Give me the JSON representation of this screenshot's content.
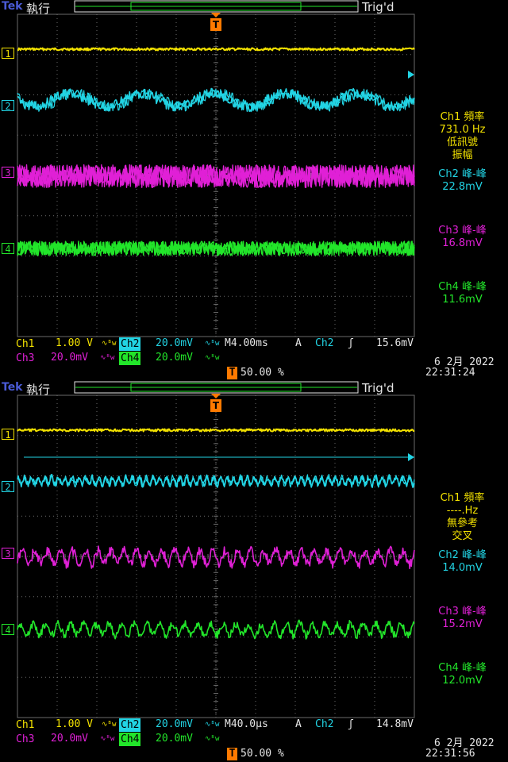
{
  "colors": {
    "ch1": "#f2e100",
    "ch2": "#22d4e4",
    "ch3": "#e020d6",
    "ch4": "#22e52a",
    "grid": "#6a6a6a",
    "trigger": "#ff7a00"
  },
  "screens": [
    {
      "brand": "Tek",
      "run_state": "執行",
      "trig_state": "Trig'd",
      "trigger_marker": "T",
      "channel_markers": [
        "1",
        "2",
        "3",
        "4"
      ],
      "measurements": [
        {
          "lines": [
            "Ch1 頻率",
            "731.0 Hz",
            "低訊號",
            "振幅"
          ],
          "color_key": "ch1"
        },
        {
          "lines": [
            "Ch2 峰-峰",
            "22.8mV"
          ],
          "color_key": "ch2"
        },
        {
          "lines": [
            "Ch3 峰-峰",
            "16.8mV"
          ],
          "color_key": "ch3"
        },
        {
          "lines": [
            "Ch4 峰-峰",
            "11.6mV"
          ],
          "color_key": "ch4"
        }
      ],
      "ch1_label": "Ch1",
      "ch1_scale": "1.00 V",
      "ch2_label": "Ch2",
      "ch2_scale": "20.0mV",
      "ch3_label": "Ch3",
      "ch3_scale": "20.0mV",
      "ch4_label": "Ch4",
      "ch4_scale": "20.0mV",
      "bw_symbol": "∿ᴮw",
      "timebase": "M4.00ms",
      "coupling": "A",
      "trig_source": "Ch2",
      "trig_slope": "ʃ",
      "trig_level": "15.6mV",
      "trig_position_marker": "T",
      "trig_position": "50.00 %",
      "date": "6 2月  2022",
      "time": "22:31:24",
      "traces": {
        "ch2_period_div": 1.8,
        "ch2_amp": 14,
        "ch3_amp": 13,
        "ch4_amp": 9,
        "ch3_ripple": false
      }
    },
    {
      "brand": "Tek",
      "run_state": "執行",
      "trig_state": "Trig'd",
      "trigger_marker": "T",
      "channel_markers": [
        "1",
        "2",
        "3",
        "4"
      ],
      "measurements": [
        {
          "lines": [
            "Ch1 頻率",
            "----.Hz",
            "無參考",
            "交叉"
          ],
          "color_key": "ch1"
        },
        {
          "lines": [
            "Ch2 峰-峰",
            "14.0mV"
          ],
          "color_key": "ch2"
        },
        {
          "lines": [
            "Ch3 峰-峰",
            "15.2mV"
          ],
          "color_key": "ch3"
        },
        {
          "lines": [
            "Ch4 峰-峰",
            "12.0mV"
          ],
          "color_key": "ch4"
        }
      ],
      "ch1_label": "Ch1",
      "ch1_scale": "1.00 V",
      "ch2_label": "Ch2",
      "ch2_scale": "20.0mV",
      "ch3_label": "Ch3",
      "ch3_scale": "20.0mV",
      "ch4_label": "Ch4",
      "ch4_scale": "20.0mV",
      "bw_symbol": "∿ᴮw",
      "timebase": "M40.0µs",
      "coupling": "A",
      "trig_source": "Ch2",
      "trig_slope": "ʃ",
      "trig_level": "14.8mV",
      "trig_position_marker": "T",
      "trig_position": "50.00 %",
      "date": "6 2月  2022",
      "time": "22:31:56",
      "traces": {
        "ch2_period_div": 0.17,
        "ch2_amp": 8,
        "ch3_amp": 12,
        "ch4_amp": 10,
        "ch3_ripple": true
      }
    }
  ]
}
